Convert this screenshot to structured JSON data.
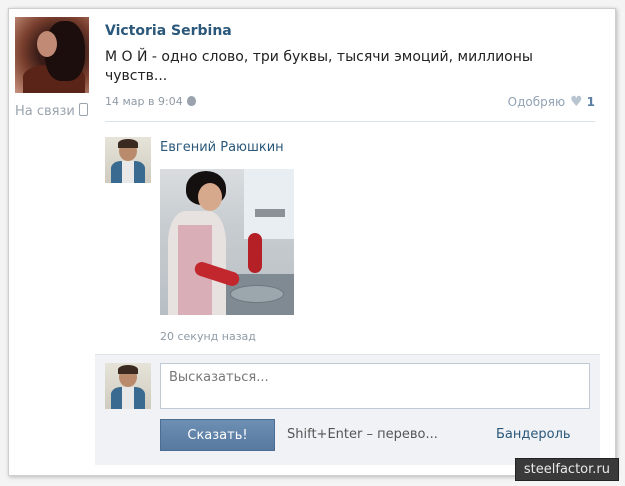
{
  "post": {
    "author": "Victoria Serbina",
    "text": "М О Й - одно слово, три буквы, тысячи эмоций, миллионы чувств...",
    "date": "14 мар в 9:04",
    "status": "На связи",
    "like_label": "Одобряю",
    "like_count": "1"
  },
  "comment": {
    "author": "Евгений Раюшкин",
    "time": "20 секунд назад"
  },
  "reply": {
    "placeholder": "Высказаться...",
    "send_label": "Сказать!",
    "hint": "Shift+Enter – перево...",
    "parcel_label": "Бандероль"
  },
  "watermark": "steelfactor.ru",
  "icons": {
    "phone": "mobile-phone-icon",
    "apple": "apple-icon",
    "like": "heart-icon"
  },
  "colors": {
    "link": "#2b587a",
    "button": "#5f82a8",
    "muted": "#8e9aa5"
  }
}
